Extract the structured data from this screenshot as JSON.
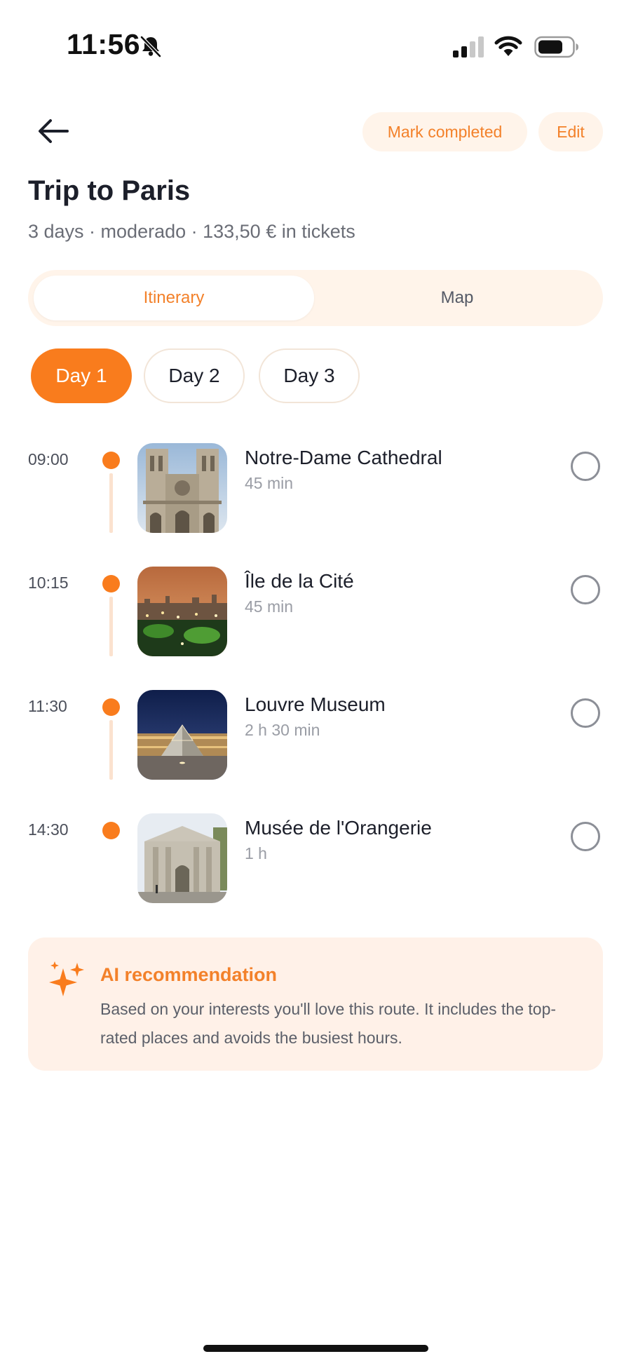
{
  "status_bar": {
    "time": "11:56",
    "icons": [
      "bell-slash-icon",
      "cellular-signal-icon",
      "wifi-icon",
      "battery-icon"
    ]
  },
  "header": {
    "back_icon": "arrow-left-icon",
    "mark_completed_label": "Mark completed",
    "edit_label": "Edit",
    "title": "Trip to Paris",
    "subtitle": "3 days · moderado · 133,50 € in tickets"
  },
  "tabs": [
    {
      "label": "Itinerary",
      "active": true
    },
    {
      "label": "Map",
      "active": false
    }
  ],
  "days": [
    {
      "label": "Day 1",
      "active": true
    },
    {
      "label": "Day 2",
      "active": false
    },
    {
      "label": "Day 3",
      "active": false
    }
  ],
  "stops": [
    {
      "time": "09:00",
      "name": "Notre-Dame Cathedral",
      "duration": "45 min",
      "completed": false
    },
    {
      "time": "10:15",
      "name": "Île de la Cité",
      "duration": "45 min",
      "completed": false
    },
    {
      "time": "11:30",
      "name": "Louvre Museum",
      "duration": "2 h 30 min",
      "completed": false
    },
    {
      "time": "14:30",
      "name": "Musée de l'Orangerie",
      "duration": "1 h",
      "completed": false
    }
  ],
  "ai_recommendation": {
    "icon": "sparkles-icon",
    "title": "AI recommendation",
    "text": "Based on your interests you'll love this route. It includes the top-rated places and avoids the busiest hours."
  },
  "colors": {
    "accent": "#f97c1d",
    "accent_text": "#f3812a",
    "accent_soft": "#fff4ea",
    "title_text": "#1c1f2a"
  }
}
